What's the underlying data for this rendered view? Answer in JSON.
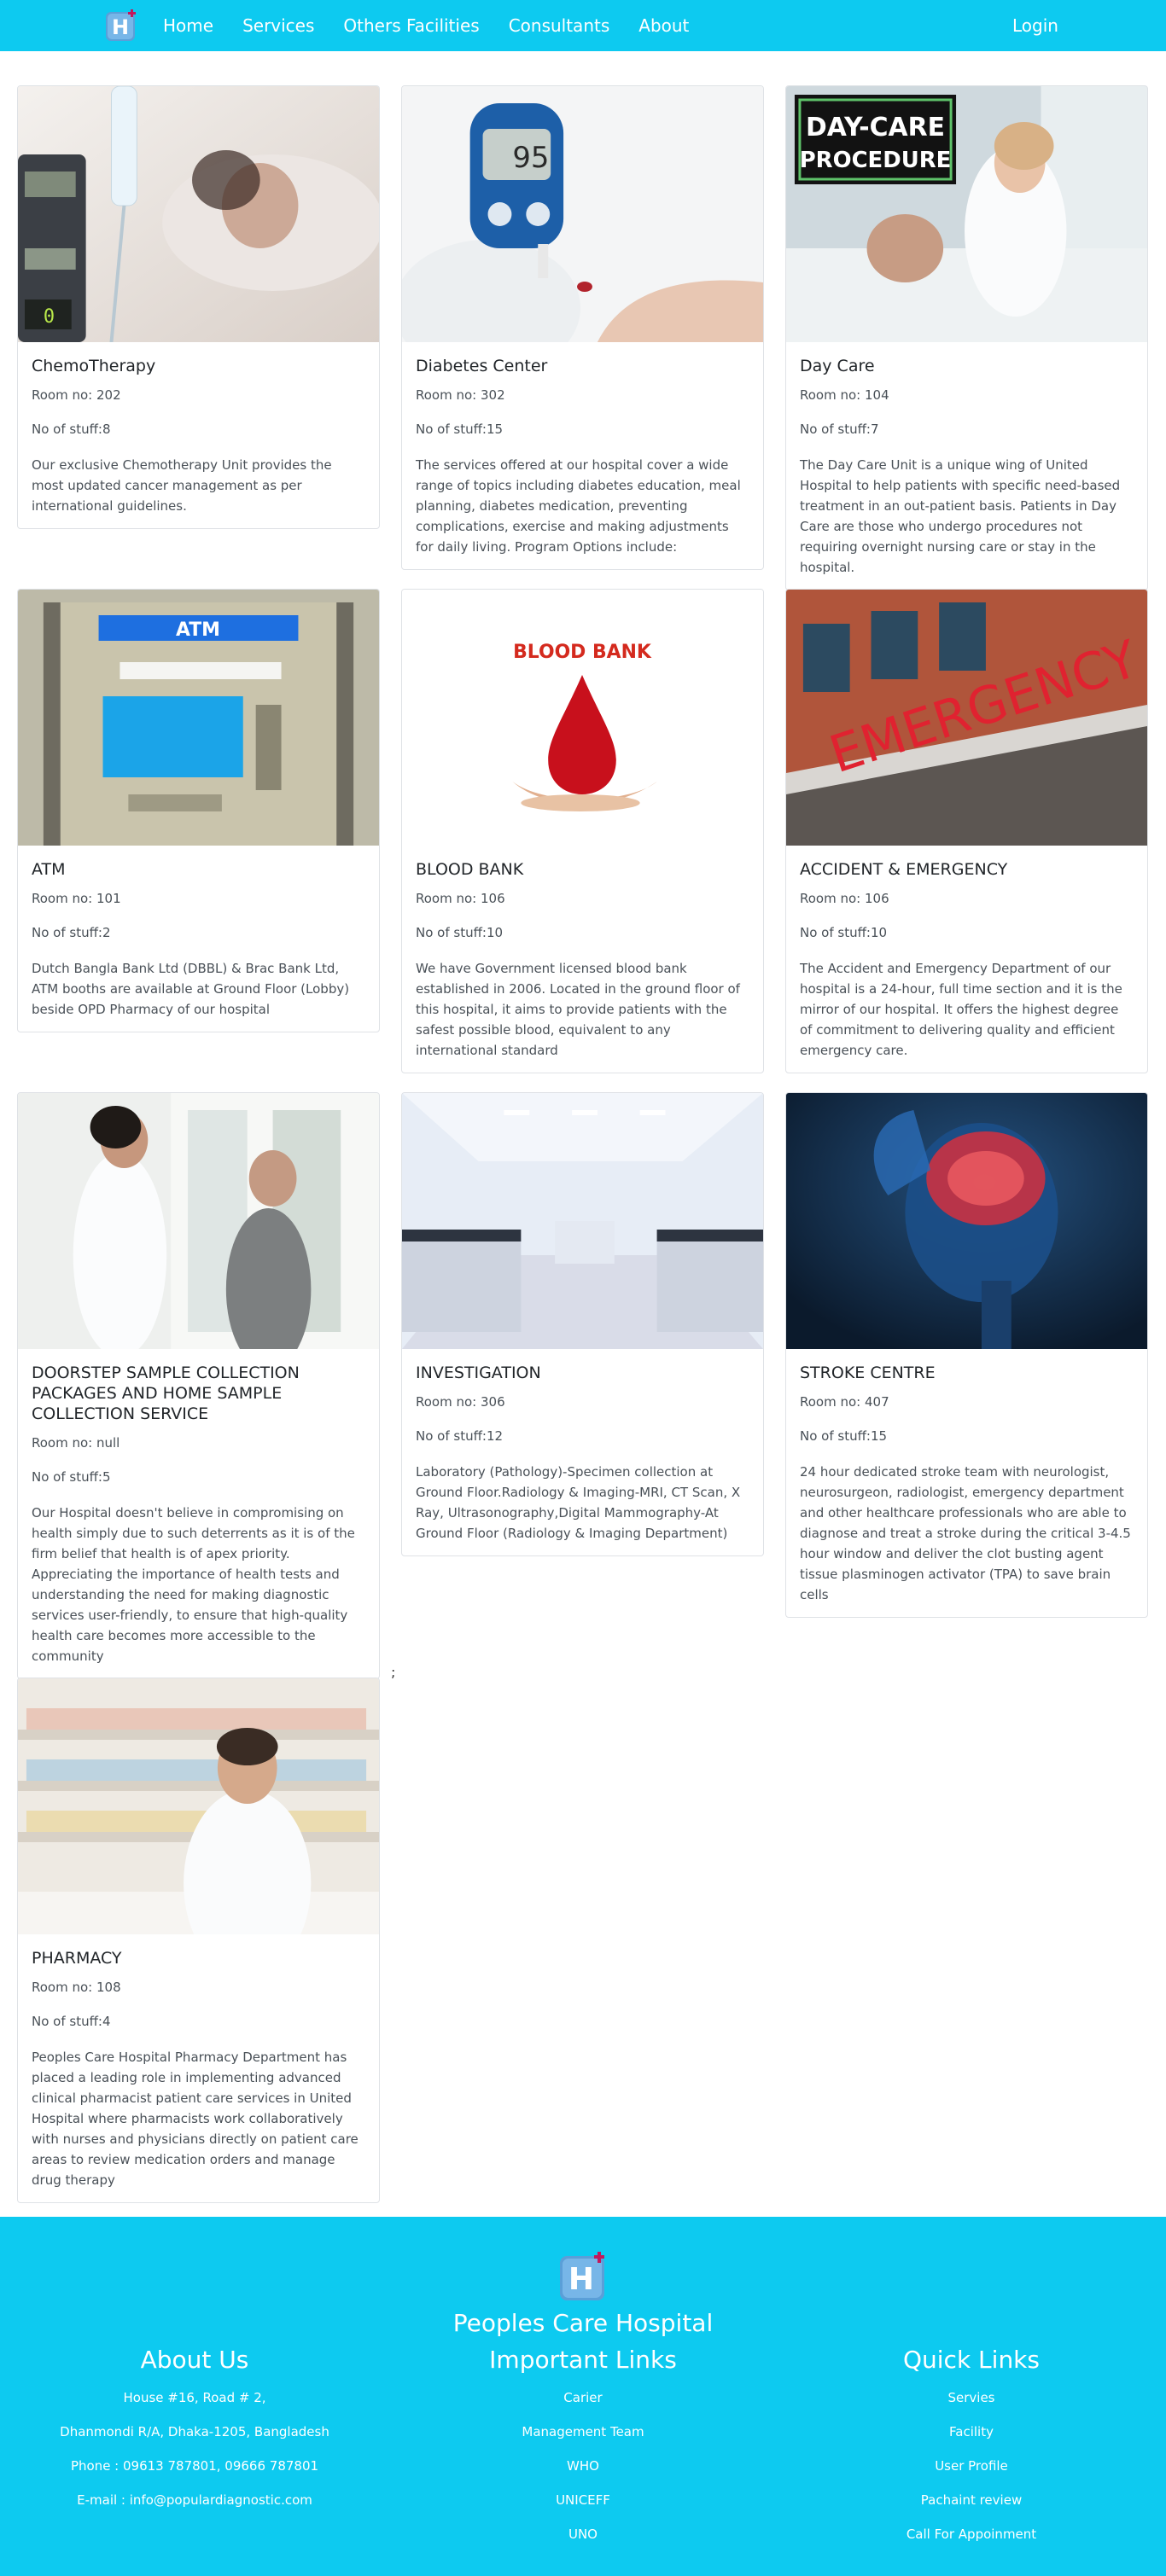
{
  "nav": {
    "logo": "hospital-logo",
    "links": [
      "Home",
      "Services",
      "Others Facilities",
      "Consultants",
      "About"
    ],
    "login": "Login"
  },
  "cards": [
    {
      "title": "ChemoTherapy",
      "room": "Room no: 202",
      "staff": "No of stuff:8",
      "text": "Our exclusive Chemotherapy Unit provides the most updated cancer management as per international guidelines."
    },
    {
      "title": "Diabetes Center",
      "room": "Room no: 302",
      "staff": "No of stuff:15",
      "text": "The services offered at our hospital cover a wide range of topics including diabetes education, meal planning, diabetes medication, preventing complications, exercise and making adjustments for daily living. Program Options include:"
    },
    {
      "title": "Day Care",
      "room": "Room no: 104",
      "staff": "No of stuff:7",
      "text": "The Day Care Unit is a unique wing of United Hospital to help patients with specific need-based treatment in an out-patient basis. Patients in Day Care are those who undergo procedures not requiring overnight nursing care or stay in the hospital.",
      "image_text": [
        "DAY-CARE",
        "PROCEDURE"
      ]
    },
    {
      "title": "ATM",
      "room": "Room no: 101",
      "staff": "No of stuff:2",
      "text": "Dutch Bangla Bank Ltd (DBBL) & Brac Bank Ltd, ATM booths are available at Ground Floor (Lobby) beside OPD Pharmacy of our hospital",
      "image_text": [
        "ATM"
      ]
    },
    {
      "title": "BLOOD BANK",
      "room": "Room no: 106",
      "staff": "No of stuff:10",
      "text": "We have Government licensed blood bank established in 2006. Located in the ground floor of this hospital, it aims to provide patients with the safest possible blood, equivalent to any international standard",
      "image_text": [
        "BLOOD BANK"
      ]
    },
    {
      "title": "ACCIDENT & EMERGENCY",
      "room": "Room no: 106",
      "staff": "No of stuff:10",
      "text": "The Accident and Emergency Department of our hospital is a 24-hour, full time section and it is the mirror of our hospital. It offers the highest degree of commitment to delivering quality and efficient emergency care.",
      "image_text": [
        "EMERGENCY"
      ]
    },
    {
      "title": "DOORSTEP SAMPLE COLLECTION PACKAGES AND HOME SAMPLE COLLECTION SERVICE",
      "room": "Room no: null",
      "staff": "No of stuff:5",
      "text": "Our Hospital doesn't believe in compromising on health simply due to such deterrents as it is of the firm belief that health is of apex priority. Appreciating the importance of health tests and understanding the need for making diagnostic services user-friendly, to ensure that high-quality health care becomes more accessible to the community"
    },
    {
      "title": "INVESTIGATION",
      "room": "Room no: 306",
      "staff": "No of stuff:12",
      "text": "Laboratory (Pathology)-Specimen collection at Ground Floor.Radiology & Imaging-MRI, CT Scan, X Ray, Ultrasonography,Digital Mammography-At Ground Floor (Radiology & Imaging Department)"
    },
    {
      "title": "STROKE CENTRE",
      "room": "Room no: 407",
      "staff": "No of stuff:15",
      "text": "24 hour dedicated stroke team with neurologist, neurosurgeon, radiologist, emergency department and other healthcare professionals who are able to diagnose and treat a stroke during the critical 3-4.5 hour window and deliver the clot busting agent tissue plasminogen activator (TPA) to save brain cells"
    },
    {
      "title": "PHARMACY",
      "room": "Room no: 108",
      "staff": "No of stuff:4",
      "text": "Peoples Care Hospital Pharmacy Department has placed a leading role in implementing advanced clinical pharmacist patient care services in United Hospital where pharmacists work collaboratively with nurses and physicians directly on patient care areas to review medication orders and manage drug therapy"
    }
  ],
  "stray_text": ";",
  "footer": {
    "title": "Peoples Care Hospital",
    "about": {
      "heading": "About Us",
      "items": [
        "House #16, Road # 2,",
        "Dhanmondi R/A, Dhaka-1205, Bangladesh",
        "Phone : 09613 787801, 09666 787801",
        "E-mail : info@populardiagnostic.com"
      ]
    },
    "important": {
      "heading": "Important Links",
      "items": [
        "Carier",
        "Management Team",
        "WHO",
        "UNICEFF",
        "UNO"
      ]
    },
    "quick": {
      "heading": "Quick Links",
      "items": [
        "Servies",
        "Facility",
        "User Profile",
        "Pachaint review",
        "Call For Appoinment"
      ]
    }
  },
  "colors": {
    "primary": "#0dcaf0"
  }
}
